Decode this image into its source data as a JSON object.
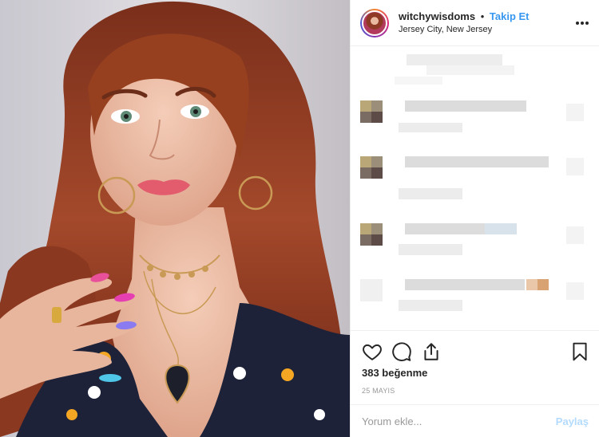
{
  "post": {
    "image_alt": "Portrait photo of a woman with auburn hair and colorful nails",
    "author": {
      "username": "witchywisdoms",
      "separator": "•",
      "follow_label": "Takip Et",
      "location": "Jersey City, New Jersey"
    },
    "likes_text": "383 beğenme",
    "date_text": "25 MAYIS",
    "comment_placeholder": "Yorum ekle...",
    "share_label": "Paylaş"
  },
  "icons": {
    "more": "more-horizontal-icon",
    "like": "heart-icon",
    "comment": "speech-bubble-icon",
    "share": "share-upload-icon",
    "save": "bookmark-icon"
  },
  "colors": {
    "accent": "#3897f0",
    "share_disabled": "#b3dbff",
    "text": "#262626",
    "muted": "#999999",
    "border": "#efefef"
  }
}
